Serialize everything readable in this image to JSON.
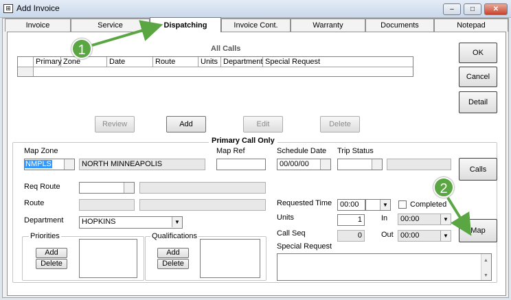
{
  "window": {
    "title": "Add Invoice",
    "app_icon_glyph": "⊞",
    "minimize_glyph": "–",
    "maximize_glyph": "□",
    "close_glyph": "✕"
  },
  "tabs": [
    {
      "label": "Invoice"
    },
    {
      "label": "Service"
    },
    {
      "label": "Dispatching"
    },
    {
      "label": "Invoice Cont."
    },
    {
      "label": "Warranty"
    },
    {
      "label": "Documents"
    },
    {
      "label": "Notepad"
    }
  ],
  "side_buttons": {
    "ok": "OK",
    "cancel": "Cancel",
    "detail": "Detail",
    "calls": "Calls",
    "map": "Map"
  },
  "all_calls": {
    "title": "All Calls",
    "columns": [
      "Primary",
      "Zone",
      "Date",
      "Route",
      "Units",
      "Department",
      "Special Request"
    ],
    "buttons": {
      "review": "Review",
      "add": "Add",
      "edit": "Edit",
      "delete": "Delete"
    }
  },
  "primary_call": {
    "title": "Primary Call Only",
    "map_zone_label": "Map Zone",
    "map_zone_code": "NMPLS",
    "map_zone_name": "NORTH MINNEAPOLIS",
    "map_ref_label": "Map Ref",
    "map_ref_value": "",
    "schedule_date_label": "Schedule Date",
    "schedule_date_value": "00/00/00",
    "trip_status_label": "Trip Status",
    "req_route_label": "Req Route",
    "route_label": "Route",
    "department_label": "Department",
    "department_value": "HOPKINS",
    "requested_time_label": "Requested Time",
    "requested_time_value": "00:00",
    "completed_label": "Completed",
    "units_label": "Units",
    "units_value": "1",
    "in_label": "In",
    "in_value": "00:00",
    "call_seq_label": "Call Seq",
    "call_seq_value": "0",
    "out_label": "Out",
    "out_value": "00:00",
    "special_request_label": "Special Request",
    "priorities_label": "Priorities",
    "qualifications_label": "Qualifications",
    "add_label": "Add",
    "delete_label": "Delete"
  },
  "callouts": [
    "1",
    "2"
  ],
  "colors": {
    "callout_green": "#5aa642",
    "selection_blue": "#3399ff"
  },
  "icons": {
    "dropdown": "▼",
    "scroll_up": "▲",
    "scroll_down": "▼"
  }
}
